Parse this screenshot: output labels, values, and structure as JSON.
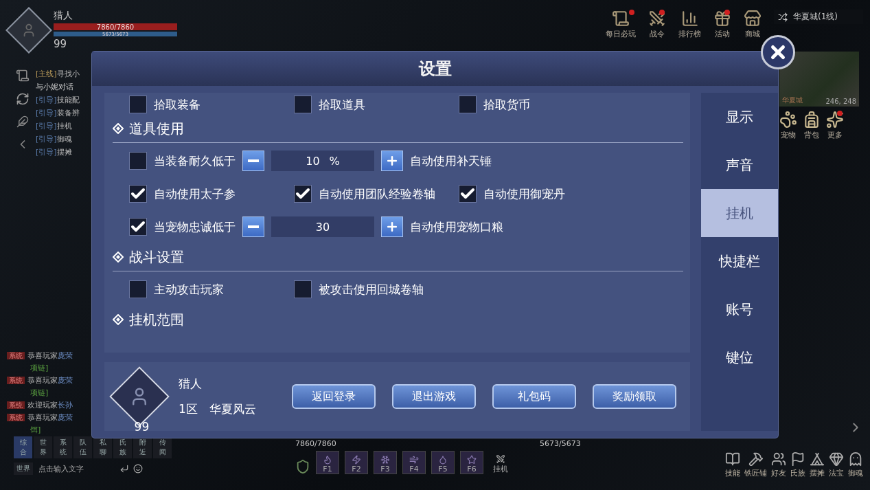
{
  "hud": {
    "player": {
      "name": "猎人",
      "hp": "7860/7860",
      "mp": "5673/5673",
      "level": "99"
    },
    "top_menu": [
      {
        "label": "每日必玩",
        "alert": true
      },
      {
        "label": "战令",
        "alert": true
      },
      {
        "label": "排行榜",
        "alert": false
      },
      {
        "label": "活动",
        "alert": true
      },
      {
        "label": "商城",
        "alert": false
      }
    ],
    "map": {
      "title": "华夏城(1线)",
      "area": "华夏城",
      "coords": "246, 248"
    },
    "side_menu": [
      {
        "label": "宠物",
        "alert": false
      },
      {
        "label": "背包",
        "alert": false
      },
      {
        "label": "更多",
        "alert": true
      }
    ],
    "quests": [
      {
        "kind": "main",
        "tag": "[主线]",
        "text": "寻找小"
      },
      {
        "kind": "note",
        "text": "与小妮对话"
      },
      {
        "kind": "guide",
        "tag": "[引导]",
        "text": "技能配"
      },
      {
        "kind": "guide",
        "tag": "[引导]",
        "text": "装备辨"
      },
      {
        "kind": "guide",
        "tag": "[引导]",
        "text": "挂机"
      },
      {
        "kind": "guide",
        "tag": "[引导]",
        "text": "御魂"
      },
      {
        "kind": "guide",
        "tag": "[引导]",
        "text": "摆摊"
      }
    ],
    "chat": [
      {
        "kind": "line",
        "tag": "系统",
        "text": "恭喜玩家",
        "name": "庞荣"
      },
      {
        "kind": "item",
        "text": "项链]"
      },
      {
        "kind": "line",
        "tag": "系统",
        "text": "恭喜玩家",
        "name": "庞荣"
      },
      {
        "kind": "item",
        "text": "项链]"
      },
      {
        "kind": "line",
        "tag": "系统",
        "text": "欢迎玩家",
        "name": "长孙"
      },
      {
        "kind": "line",
        "tag": "系统",
        "text": "恭喜玩家",
        "name": "庞荣"
      },
      {
        "kind": "item",
        "text": "饵]"
      }
    ],
    "chat_tabs": [
      {
        "label": "综合",
        "selected": true
      },
      {
        "label": "世界",
        "selected": false
      },
      {
        "label": "系统",
        "selected": false
      },
      {
        "label": "队伍",
        "selected": false
      },
      {
        "label": "私聊",
        "selected": false
      },
      {
        "label": "氏族",
        "selected": false
      },
      {
        "label": "附近",
        "selected": false
      },
      {
        "label": "传闻",
        "selected": false
      }
    ],
    "chat_input": {
      "channel": "世界",
      "placeholder": "点击输入文字"
    },
    "bars": {
      "hp": "7860/7860",
      "mp": "5673/5673"
    },
    "skills": [
      "F1",
      "F2",
      "F3",
      "F4",
      "F5",
      "F6"
    ],
    "auto_label": "挂机",
    "bottom_menu": [
      "技能",
      "铁匠铺",
      "好友",
      "氏族",
      "摆摊",
      "法宝",
      "御魂"
    ]
  },
  "dialog": {
    "title": "设置",
    "nav": [
      {
        "label": "显示",
        "selected": false
      },
      {
        "label": "声音",
        "selected": false
      },
      {
        "label": "挂机",
        "selected": true
      },
      {
        "label": "快捷栏",
        "selected": false
      },
      {
        "label": "账号",
        "selected": false
      },
      {
        "label": "键位",
        "selected": false
      }
    ],
    "top_row": [
      {
        "label": "拾取装备",
        "checked": false
      },
      {
        "label": "拾取道具",
        "checked": false
      },
      {
        "label": "拾取货币",
        "checked": false
      }
    ],
    "sections": [
      {
        "title": "道具使用",
        "rows": [
          {
            "kind": "stepper",
            "checked": false,
            "label": "当装备耐久低于",
            "value": "10",
            "unit": "%",
            "action": "自动使用补天锤"
          },
          {
            "kind": "checks",
            "items": [
              {
                "label": "自动使用太子参",
                "checked": true
              },
              {
                "label": "自动使用团队经验卷轴",
                "checked": true
              },
              {
                "label": "自动使用御宠丹",
                "checked": true
              }
            ]
          },
          {
            "kind": "stepper",
            "checked": true,
            "label": "当宠物忠诚低于",
            "value": "30",
            "action": "自动使用宠物口粮"
          }
        ]
      },
      {
        "title": "战斗设置",
        "rows": [
          {
            "kind": "checks",
            "items": [
              {
                "label": "主动攻击玩家",
                "checked": false
              },
              {
                "label": "被攻击使用回城卷轴",
                "checked": false
              }
            ]
          }
        ]
      },
      {
        "title": "挂机范围"
      }
    ],
    "profile": {
      "name": "猎人",
      "level": "99",
      "server": "1区",
      "realm": "华夏风云"
    },
    "buttons": [
      "返回登录",
      "退出游戏",
      "礼包码",
      "奖励领取"
    ]
  }
}
